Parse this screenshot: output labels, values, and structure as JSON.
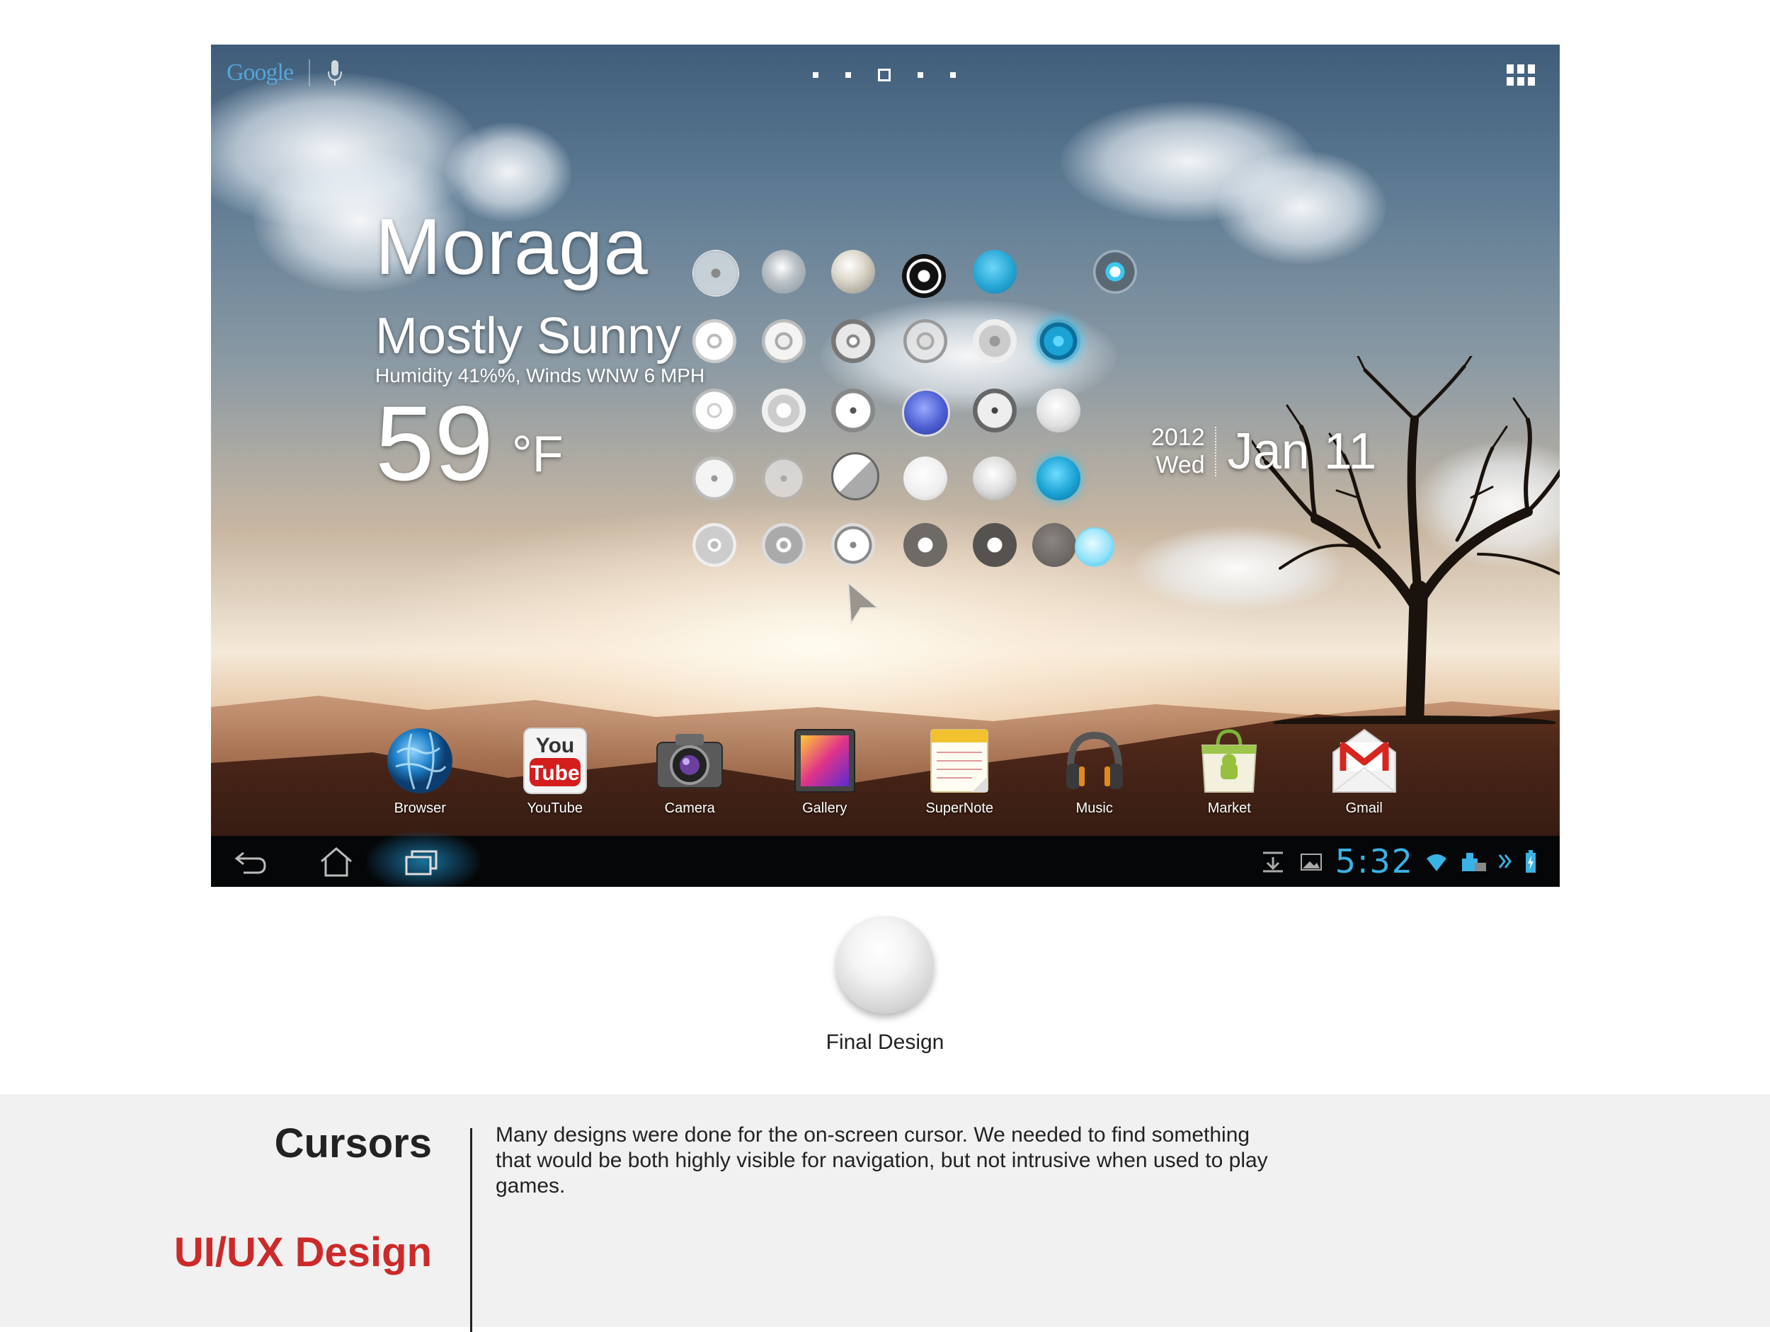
{
  "screen": {
    "google_logo": "Google",
    "page_indicator": {
      "count": 5,
      "active_index": 2
    },
    "weather": {
      "city": "Moraga",
      "condition": "Mostly Sunny",
      "detail": "Humidity 41%%, Winds WNW 6 MPH",
      "temperature": "59",
      "unit": "°F"
    },
    "date": {
      "year": "2012",
      "weekday": "Wed",
      "day": "Jan 11"
    },
    "dock": [
      {
        "label": "Browser",
        "icon": "globe-icon"
      },
      {
        "label": "YouTube",
        "icon": "youtube-icon"
      },
      {
        "label": "Camera",
        "icon": "camera-icon"
      },
      {
        "label": "Gallery",
        "icon": "gallery-icon"
      },
      {
        "label": "SuperNote",
        "icon": "notepad-icon"
      },
      {
        "label": "Music",
        "icon": "headphones-icon"
      },
      {
        "label": "Market",
        "icon": "market-bag-icon"
      },
      {
        "label": "Gmail",
        "icon": "gmail-envelope-icon"
      }
    ],
    "youtube_icon_text": {
      "top": "You",
      "bottom": "Tube"
    },
    "status_bar": {
      "clock": "5:32"
    },
    "accent_color": "#39b2e6"
  },
  "final_design": {
    "label": "Final Design"
  },
  "caption": {
    "title": "Cursors",
    "category": "UI/UX Design",
    "body": "Many designs were done for the on-screen cursor. We needed to find something that would be both highly visible for navigation, but not intrusive when used to play games."
  },
  "colors": {
    "category_red": "#cc2a2a",
    "caption_band": "#f1f1f1"
  }
}
